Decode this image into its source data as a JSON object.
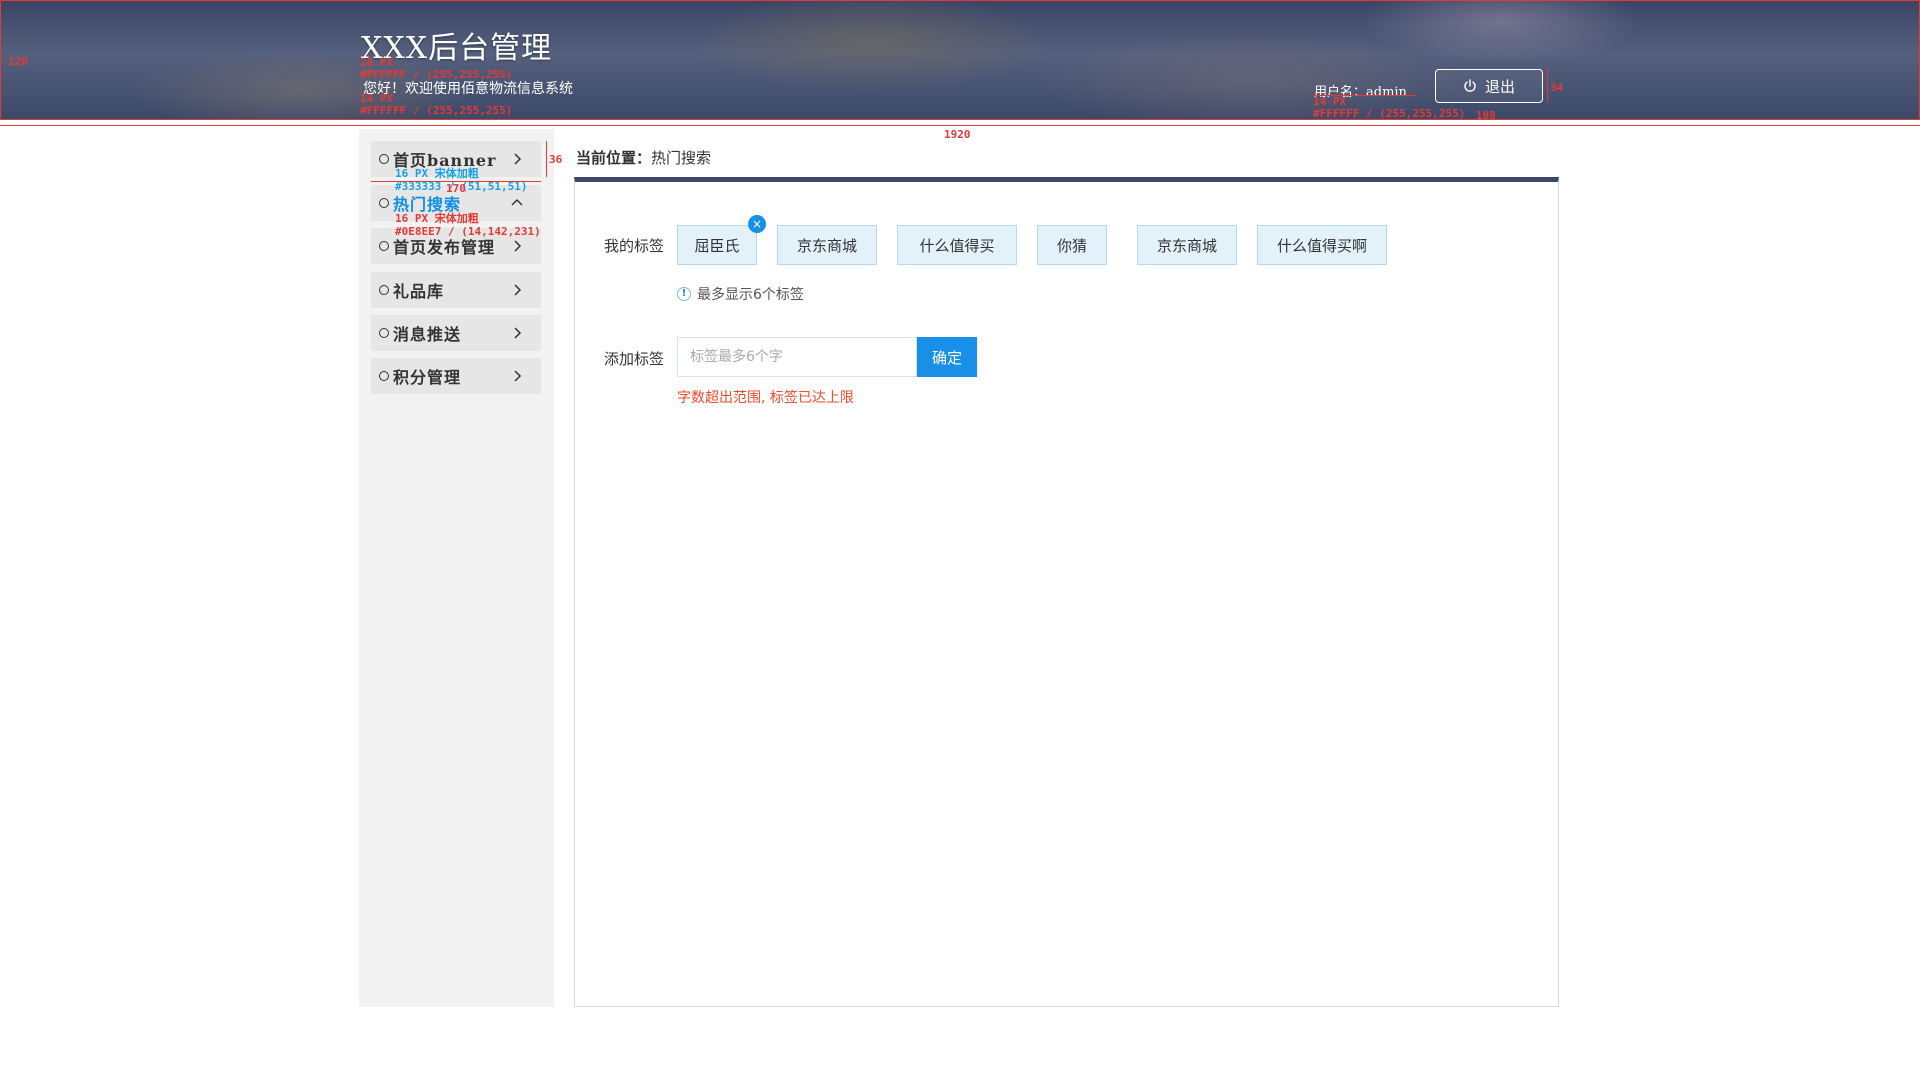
{
  "header": {
    "title": "XXX后台管理",
    "welcome": "您好！欢迎使用佰意物流信息系统",
    "user": "用户名：admin",
    "logout_label": "退出"
  },
  "annotations": {
    "header_height": "120",
    "title_size": "28 PX",
    "title_color": "#FFFFFF / (255,255,255)",
    "welcome_size": "14 PX",
    "welcome_color": "#FFFFFF / (255,255,255)",
    "page_width": "1920",
    "user_size": "14 PX",
    "user_color": "#FFFFFF / (255,255,255)",
    "logout_height": "34",
    "logout_width": "108",
    "nav_height": "36",
    "nav_width": "170",
    "nav_font": "16 PX 宋体加粗",
    "nav_color": "#333333 / (51,51,51)",
    "active_font": "16 PX 宋体加粗",
    "active_color": "#0E8EE7 / (14,142,231)"
  },
  "sidebar": {
    "items": [
      {
        "label": "首页banner",
        "chevron": "right"
      },
      {
        "label": "热门搜索",
        "chevron": "up",
        "active": true
      },
      {
        "label": "首页发布管理",
        "chevron": "right"
      },
      {
        "label": "礼品库",
        "chevron": "right"
      },
      {
        "label": "消息推送",
        "chevron": "right"
      },
      {
        "label": "积分管理",
        "chevron": "right"
      }
    ]
  },
  "breadcrumb": {
    "label": "当前位置：",
    "current": "热门搜索"
  },
  "tags_section": {
    "label": "我的标签",
    "tags": [
      "屈臣氏",
      "京东商城",
      "什么值得买",
      "你猜",
      "京东商城",
      "什么值得买啊"
    ],
    "close_glyph": "×",
    "hint": "最多显示6个标签",
    "info_glyph": "!"
  },
  "add_section": {
    "label": "添加标签",
    "placeholder": "标签最多6个字",
    "confirm_label": "确定",
    "error": "字数超出范围, 标签已达上限"
  },
  "colors": {
    "accent": "#1890e8",
    "active_nav": "#0e8ee7",
    "error": "#f04a2a",
    "annotation": "#e53935"
  }
}
